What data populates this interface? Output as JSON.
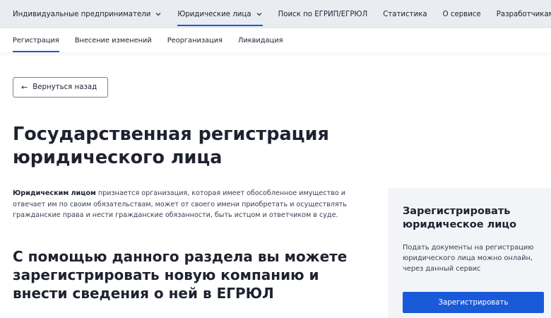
{
  "topnav": {
    "items": [
      {
        "label": "Индивидуальные предприниматели",
        "has_dropdown": true,
        "active": false
      },
      {
        "label": "Юридические лица",
        "has_dropdown": true,
        "active": true
      },
      {
        "label": "Поиск по ЕГРИП/ЕГРЮЛ",
        "has_dropdown": false,
        "active": false
      },
      {
        "label": "Статистика",
        "has_dropdown": false,
        "active": false
      },
      {
        "label": "О сервисе",
        "has_dropdown": false,
        "active": false
      },
      {
        "label": "Разработчикам",
        "has_dropdown": false,
        "active": false
      }
    ]
  },
  "subnav": {
    "items": [
      {
        "label": "Регистрация",
        "active": true
      },
      {
        "label": "Внесение изменений",
        "active": false
      },
      {
        "label": "Реорганизация",
        "active": false
      },
      {
        "label": "Ликвидация",
        "active": false
      }
    ]
  },
  "back": {
    "arrow": "←",
    "label": "Вернуться назад"
  },
  "main": {
    "title": "Государственная регистрация юридического лица",
    "intro_bold": "Юридическим лицом",
    "intro_text": " признается организация, которая имеет обособленное имущество и отвечает им по своим обязательствам, может от своего имени приобретать и осуществлять гражданские права и нести гражданские обязанности, быть истцом и ответчиком в суде.",
    "subtitle": "С помощью данного раздела вы можете зарегистрировать новую компанию и внести сведения о ней в ЕГРЮЛ"
  },
  "card": {
    "title": "Зарегистрировать юридическое лицо",
    "text": "Подать документы на регистрацию юридического лица можно онлайн, через данный сервис",
    "button": "Зарегистрировать"
  },
  "colors": {
    "accent": "#1a5ad9",
    "topnav_bg": "#e9ecf1",
    "card_bg": "#f2f4f7",
    "text": "#1e2230"
  },
  "icons": {
    "dropdown": "chevron-down-icon",
    "back": "arrow-left-icon"
  }
}
